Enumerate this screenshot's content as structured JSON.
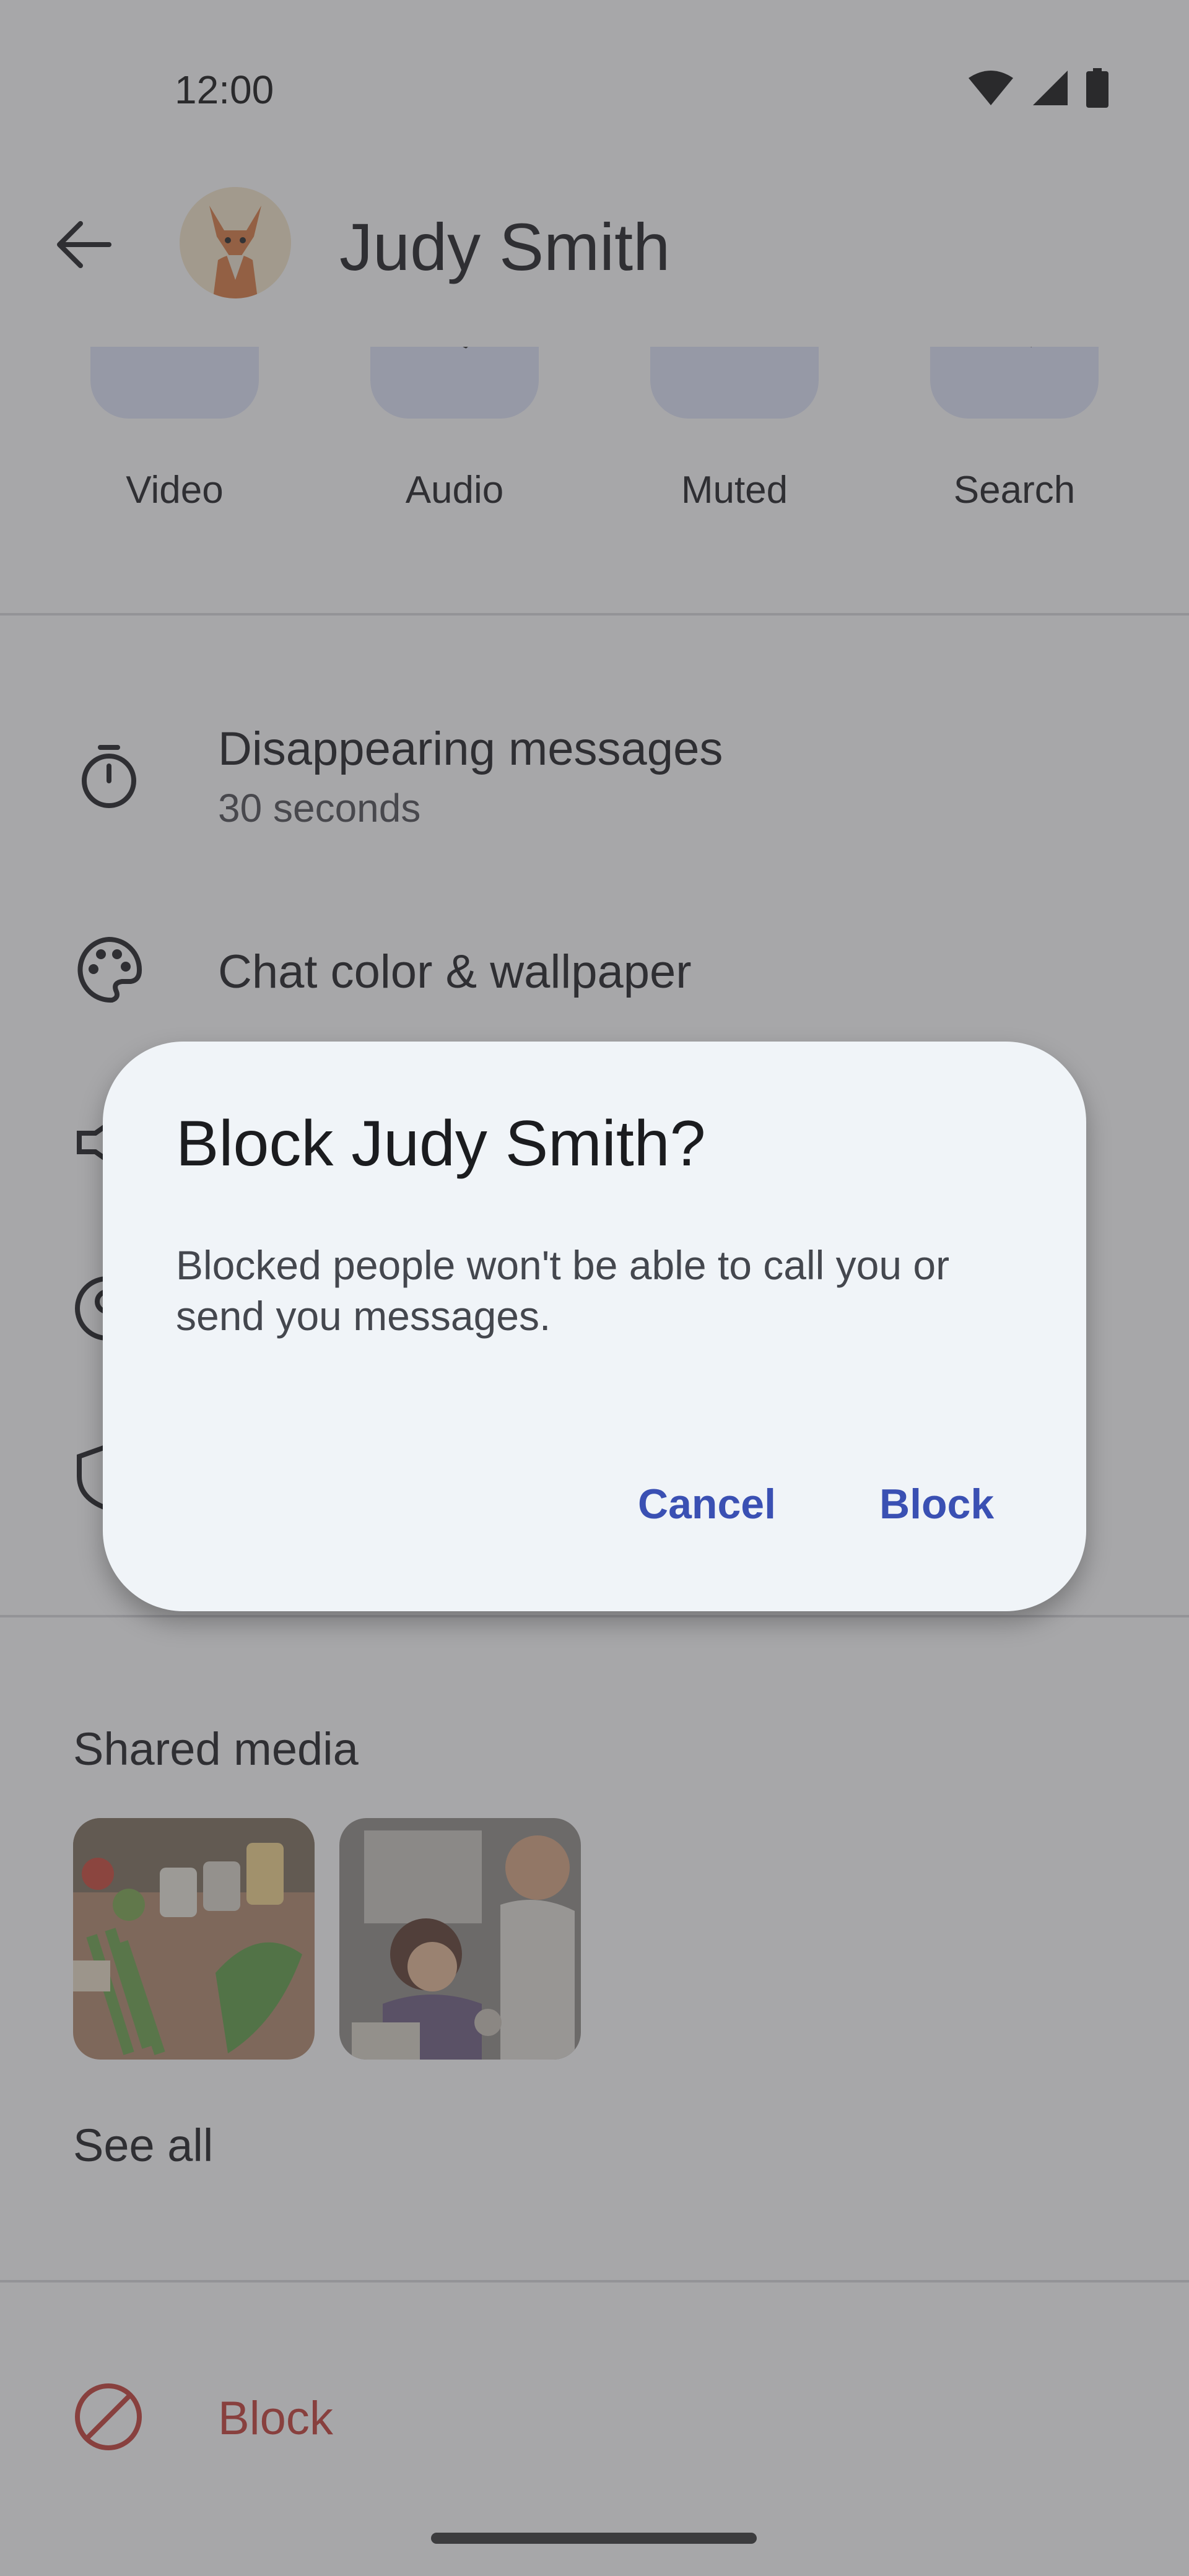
{
  "status_bar": {
    "time": "12:00"
  },
  "header": {
    "contact_name": "Judy Smith"
  },
  "actions": [
    {
      "label": "Video",
      "icon": "video-icon"
    },
    {
      "label": "Audio",
      "icon": "phone-icon"
    },
    {
      "label": "Muted",
      "icon": "bell-off-icon"
    },
    {
      "label": "Search",
      "icon": "search-icon"
    }
  ],
  "settings": {
    "disappearing": {
      "title": "Disappearing messages",
      "subtitle": "30 seconds",
      "icon": "timer-icon"
    },
    "chat_color": {
      "title": "Chat color & wallpaper",
      "icon": "palette-icon"
    }
  },
  "shared_media": {
    "title": "Shared media",
    "see_all": "See all"
  },
  "block_row": {
    "label": "Block",
    "icon": "block-icon"
  },
  "dialog": {
    "title": "Block Judy Smith?",
    "body": "Blocked people won't be able to call you or send you messages.",
    "cancel": "Cancel",
    "confirm": "Block"
  },
  "colors": {
    "accent": "#3a50b3",
    "danger": "#c33b33",
    "tile": "#dee3f8",
    "dialog_bg": "#f0f4f8"
  }
}
